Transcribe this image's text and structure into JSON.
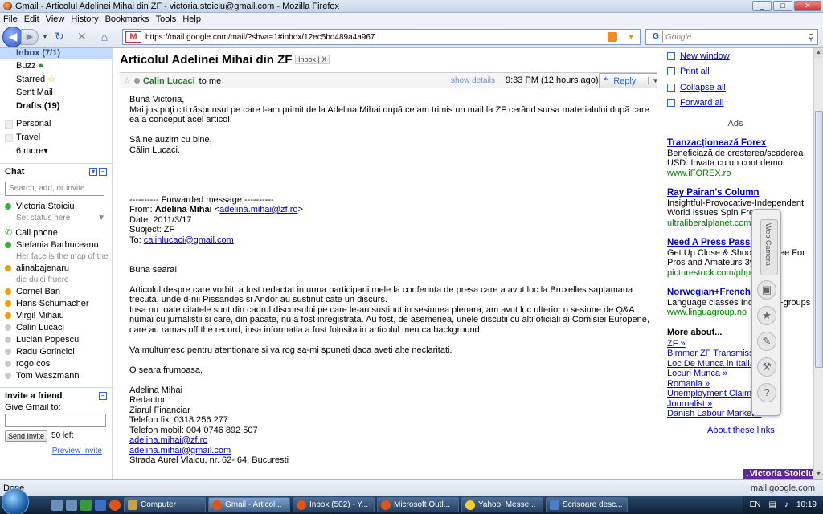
{
  "window": {
    "title": "Gmail - Articolul Adelinei Mihai din ZF - victoria.stoiciu@gmail.com - Mozilla Firefox"
  },
  "menu": [
    "File",
    "Edit",
    "View",
    "History",
    "Bookmarks",
    "Tools",
    "Help"
  ],
  "nav": {
    "url": "https://mail.google.com/mail/?shva=1#inbox/12ec5bd489a4a967",
    "search_placeholder": "Google"
  },
  "sidebar": {
    "nav_items": [
      "Inbox (7/1)",
      "Buzz",
      "Starred",
      "Sent Mail",
      "Drafts (19)"
    ],
    "labels": [
      "Personal",
      "Travel"
    ],
    "more": "6 more▾",
    "chat_title": "Chat",
    "chat_search_placeholder": "Search, add, or invite",
    "self_name": "Victoria Stoiciu",
    "self_status": "Set status here",
    "call_phone": "Call phone",
    "contacts": [
      {
        "name": "Stefania Barbuceanu",
        "status": "Her face is the map of the",
        "color": "green"
      },
      {
        "name": "alinabajenaru",
        "status": "die dulci fruere",
        "color": "orange"
      },
      {
        "name": "Cornel Ban",
        "color": "orange"
      },
      {
        "name": "Hans Schumacher",
        "color": "orange"
      },
      {
        "name": "Virgil Mihaiu",
        "color": "orange"
      },
      {
        "name": "Calin Lucaci",
        "color": "gray"
      },
      {
        "name": "Lucian Popescu",
        "color": "gray"
      },
      {
        "name": "Radu Gorincioi",
        "color": "gray"
      },
      {
        "name": "rogo cos",
        "color": "gray"
      },
      {
        "name": "Tom Waszmann",
        "color": "gray"
      }
    ],
    "invite_title": "Invite a friend",
    "invite_label": "Give Gmail to:",
    "invite_button": "Send Invite",
    "invite_left": "50 left",
    "preview_invite": "Preview Invite"
  },
  "message": {
    "subject": "Articolul Adelinei Mihai din ZF",
    "tag": "Inbox",
    "tag_close": "X",
    "sender": "Calin Lucaci",
    "to": "to me",
    "show_details": "show details",
    "time": "9:33 PM (12 hours ago)",
    "reply": "Reply",
    "body": {
      "greeting": "Bună Victoria,",
      "p1": "Mai jos poţi citi răspunsul pe care l-am primit de la Adelina Mihai după ce am trimis un mail la ZF cerând sursa materialului după care ea a conceput acel articol.",
      "closing1": "Să ne auzim cu bine,",
      "closing2": "Călin Lucaci.",
      "fwd_header": "---------- Forwarded message ----------",
      "from_label": "From: ",
      "from_name": "Adelina Mihai",
      "from_email": "adelina.mihai@zf.ro",
      "date": "Date: 2011/3/17",
      "subject_line": "Subject: ZF",
      "to_label": "To: ",
      "to_email": "calinlucaci@gmail.com",
      "f_greeting": "Buna seara!",
      "f_p1": "Articolul despre care vorbiti a fost redactat in urma participarii mele la conferinta de presa care a avut loc la Bruxelles saptamana trecuta, unde d-nii Pissarides si Andor au sustinut cate un discurs.",
      "f_p2": "Insa nu toate citatele sunt din cadrul discursului pe care le-au sustinut in sesiunea plenara, am avut loc ulterior o sesiune de Q&A numai cu jurnalistii si care, din pacate, nu a fost inregistrata. Au fost, de asemenea, unele discutii cu alti oficiali ai Comisiei Europene, care au ramas off the record, insa informatia a fost folosita in articolul meu ca background.",
      "f_p3": "Va multumesc pentru atentionare si va rog sa-mi spuneti daca aveti alte neclaritati.",
      "f_closing": "O seara frumoasa,",
      "sig_name": "Adelina Mihai",
      "sig_role": "Redactor",
      "sig_org": "Ziarul Financiar",
      "sig_phone": "Telefon fix: 0318 256 277",
      "sig_mobile": "Telefon mobil: 004 0746 892 507",
      "sig_email1": "adelina.mihai@zf.ro",
      "sig_email2": "adelina.mihai@gmail.com",
      "sig_address": "Strada Aurel Vlaicu, nr. 62- 64, Bucuresti"
    }
  },
  "right": {
    "actions": [
      "New window",
      "Print all",
      "Collapse all",
      "Forward all"
    ],
    "ads_title": "Ads",
    "ads": [
      {
        "title": "Tranzacţionează Forex",
        "text": "Beneficiază de cresterea/scaderea USD. Invata cu un cont demo",
        "url": "www.iFOREX.ro"
      },
      {
        "title": "Ray Pairan's Column",
        "text": "Insightful-Provocative-Independent World Issues Spin Free",
        "url": "ultraliberalplanet.com"
      },
      {
        "title": "Need A Press Pass",
        "text": "Get Up Close & Shoot ent Free For Pros and Amateurs 3yrs.",
        "url": "picturestock.com/phpo"
      },
      {
        "title": "Norwegian+French o",
        "text": "Language classes Individual+groups",
        "url": "www.linguagroup.no"
      }
    ],
    "more_about": "More about...",
    "more_links": [
      "ZF »",
      "Bimmer ZF Transmissi",
      "Loc De Munca in Italia",
      "Locuri Munca »",
      "Romania »",
      "Unemployment Claims",
      "Journalist »",
      "Danish Labour Market »"
    ],
    "about_these": "About these links"
  },
  "webcam_label": "Web Camera",
  "user_button": "Victoria Stoiciu",
  "statusbar": {
    "left": "Done",
    "right": "mail.google.com"
  },
  "taskbar": {
    "items": [
      "Computer",
      "Gmail - Articol...",
      "Inbox (502) - Y...",
      "Microsoft Outl...",
      "Yahoo! Messe...",
      "Scrisoare desc..."
    ],
    "lang": "EN",
    "clock": "10:19"
  }
}
